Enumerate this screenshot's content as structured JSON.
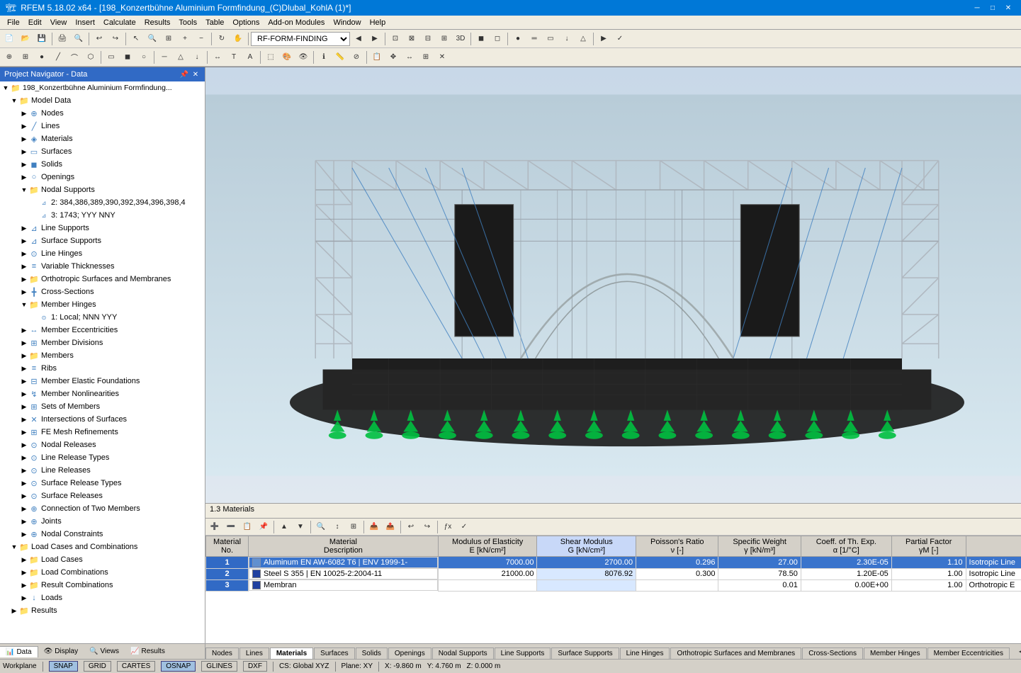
{
  "titleBar": {
    "title": "RFEM 5.18.02 x64 - [198_Konzertbühne Aluminium Formfindung_(C)Dlubal_KohlA (1)*]",
    "minBtn": "─",
    "maxBtn": "□",
    "closeBtn": "✕"
  },
  "menuBar": {
    "items": [
      "File",
      "Edit",
      "View",
      "Insert",
      "Calculate",
      "Results",
      "Tools",
      "Table",
      "Options",
      "Add-on Modules",
      "Window",
      "Help"
    ]
  },
  "toolbarDropdown": "RF-FORM-FINDING",
  "projectNavigator": {
    "title": "Project Navigator - Data",
    "projectName": "198_Konzertbühne Aluminium Formfindung...",
    "tree": [
      {
        "id": "model-data",
        "label": "Model Data",
        "level": 1,
        "expanded": true,
        "type": "folder"
      },
      {
        "id": "nodes",
        "label": "Nodes",
        "level": 2,
        "type": "item"
      },
      {
        "id": "lines",
        "label": "Lines",
        "level": 2,
        "type": "item"
      },
      {
        "id": "materials",
        "label": "Materials",
        "level": 2,
        "type": "item"
      },
      {
        "id": "surfaces",
        "label": "Surfaces",
        "level": 2,
        "type": "item"
      },
      {
        "id": "solids",
        "label": "Solids",
        "level": 2,
        "type": "item"
      },
      {
        "id": "openings",
        "label": "Openings",
        "level": 2,
        "type": "item"
      },
      {
        "id": "nodal-supports",
        "label": "Nodal Supports",
        "level": 2,
        "type": "folder",
        "expanded": true
      },
      {
        "id": "nodal-support-1",
        "label": "2: 384,386,389,390,392,394,396,398,4",
        "level": 3,
        "type": "subitem"
      },
      {
        "id": "nodal-support-2",
        "label": "3: 1743; YYY NNY",
        "level": 3,
        "type": "subitem"
      },
      {
        "id": "line-supports",
        "label": "Line Supports",
        "level": 2,
        "type": "item"
      },
      {
        "id": "surface-supports",
        "label": "Surface Supports",
        "level": 2,
        "type": "item"
      },
      {
        "id": "line-hinges",
        "label": "Line Hinges",
        "level": 2,
        "type": "item"
      },
      {
        "id": "variable-thicknesses",
        "label": "Variable Thicknesses",
        "level": 2,
        "type": "item"
      },
      {
        "id": "ortho-surfaces",
        "label": "Orthotropic Surfaces and Membranes",
        "level": 2,
        "type": "folder",
        "expanded": false
      },
      {
        "id": "cross-sections",
        "label": "Cross-Sections",
        "level": 2,
        "type": "item"
      },
      {
        "id": "member-hinges",
        "label": "Member Hinges",
        "level": 2,
        "type": "folder",
        "expanded": true
      },
      {
        "id": "member-hinge-1",
        "label": "1: Local; NNN YYY",
        "level": 3,
        "type": "subitem"
      },
      {
        "id": "member-eccentricities",
        "label": "Member Eccentricities",
        "level": 2,
        "type": "item"
      },
      {
        "id": "member-divisions",
        "label": "Member Divisions",
        "level": 2,
        "type": "item"
      },
      {
        "id": "members",
        "label": "Members",
        "level": 2,
        "type": "folder",
        "expanded": false
      },
      {
        "id": "ribs",
        "label": "Ribs",
        "level": 2,
        "type": "item"
      },
      {
        "id": "member-elastic",
        "label": "Member Elastic Foundations",
        "level": 2,
        "type": "item"
      },
      {
        "id": "member-nonlin",
        "label": "Member Nonlinearities",
        "level": 2,
        "type": "item"
      },
      {
        "id": "sets-of-members",
        "label": "Sets of Members",
        "level": 2,
        "type": "item"
      },
      {
        "id": "intersections",
        "label": "Intersections of Surfaces",
        "level": 2,
        "type": "item"
      },
      {
        "id": "fe-mesh",
        "label": "FE Mesh Refinements",
        "level": 2,
        "type": "item"
      },
      {
        "id": "nodal-releases",
        "label": "Nodal Releases",
        "level": 2,
        "type": "item"
      },
      {
        "id": "line-release-types",
        "label": "Line Release Types",
        "level": 2,
        "type": "item"
      },
      {
        "id": "line-releases",
        "label": "Line Releases",
        "level": 2,
        "type": "item"
      },
      {
        "id": "surface-release-types",
        "label": "Surface Release Types",
        "level": 2,
        "type": "item"
      },
      {
        "id": "surface-releases",
        "label": "Surface Releases",
        "level": 2,
        "type": "item"
      },
      {
        "id": "connection-two-members",
        "label": "Connection of Two Members",
        "level": 2,
        "type": "item"
      },
      {
        "id": "joints",
        "label": "Joints",
        "level": 2,
        "type": "item"
      },
      {
        "id": "nodal-constraints",
        "label": "Nodal Constraints",
        "level": 2,
        "type": "item"
      },
      {
        "id": "load-cases-combinations",
        "label": "Load Cases and Combinations",
        "level": 1,
        "type": "folder",
        "expanded": true
      },
      {
        "id": "load-cases",
        "label": "Load Cases",
        "level": 2,
        "type": "folder",
        "expanded": false
      },
      {
        "id": "load-combinations",
        "label": "Load Combinations",
        "level": 2,
        "type": "folder",
        "expanded": false
      },
      {
        "id": "result-combinations",
        "label": "Result Combinations",
        "level": 2,
        "type": "folder",
        "expanded": false
      },
      {
        "id": "loads",
        "label": "Loads",
        "level": 2,
        "type": "item"
      },
      {
        "id": "results",
        "label": "Results",
        "level": 1,
        "type": "folder",
        "expanded": false
      }
    ]
  },
  "bottomPanel": {
    "title": "1.3 Materials"
  },
  "tableColumns": {
    "headers": [
      {
        "id": "A",
        "line1": "Material",
        "line2": "No."
      },
      {
        "id": "B",
        "line1": "Material",
        "line2": "Description"
      },
      {
        "id": "C",
        "line1": "Modulus of Elasticity",
        "line2": "E [kN/cm²]"
      },
      {
        "id": "D",
        "line1": "Shear Modulus",
        "line2": "G [kN/cm²]"
      },
      {
        "id": "E",
        "line1": "Poisson's Ratio",
        "line2": "ν [-]"
      },
      {
        "id": "F",
        "line1": "Specific Weight",
        "line2": "γ [kN/m³]"
      },
      {
        "id": "G",
        "line1": "Coeff. of Th. Exp.",
        "line2": "α [1/°C]"
      },
      {
        "id": "H",
        "line1": "Partial Factor",
        "line2": "γM [-]"
      }
    ],
    "rows": [
      {
        "no": "1",
        "selected": true,
        "color": "#4080c0",
        "description": "Aluminum EN AW-6082 T6 | ENV 1999-1-",
        "E": "7000.00",
        "G": "2700.00",
        "nu": "0.296",
        "gamma": "27.00",
        "alpha": "2.30E-05",
        "partialFactor": "1.10",
        "note": "Isotropic Line"
      },
      {
        "no": "2",
        "selected": false,
        "color": "#2040a0",
        "description": "Steel S 355 | EN 10025-2:2004-11",
        "E": "21000.00",
        "G": "8076.92",
        "nu": "0.300",
        "gamma": "78.50",
        "alpha": "1.20E-05",
        "partialFactor": "1.00",
        "note": "Isotropic Line"
      },
      {
        "no": "3",
        "selected": false,
        "color": "#2040a0",
        "description": "Membran",
        "E": "",
        "G": "",
        "nu": "",
        "gamma": "0.01",
        "alpha": "0.00E+00",
        "partialFactor": "1.00",
        "note": "Orthotropic E"
      }
    ]
  },
  "bottomTabs": [
    "Nodes",
    "Lines",
    "Materials",
    "Surfaces",
    "Solids",
    "Openings",
    "Nodal Supports",
    "Line Supports",
    "Surface Supports",
    "Line Hinges",
    "Orthotropic Surfaces and Membranes",
    "Cross-Sections",
    "Member Hinges",
    "Member Eccentricities"
  ],
  "navBottomTabs": [
    "Data",
    "Display",
    "Views",
    "Results"
  ],
  "statusBar": {
    "snap": "SNAP",
    "grid": "GRID",
    "cartes": "CARTES",
    "osnap": "OSNAP",
    "glines": "GLINES",
    "dxf": "DXF",
    "cs": "CS: Global XYZ",
    "plane": "Plane: XY",
    "x": "X: -9.860 m",
    "y": "Y: 4.760 m",
    "z": "Z: 0.000 m"
  }
}
